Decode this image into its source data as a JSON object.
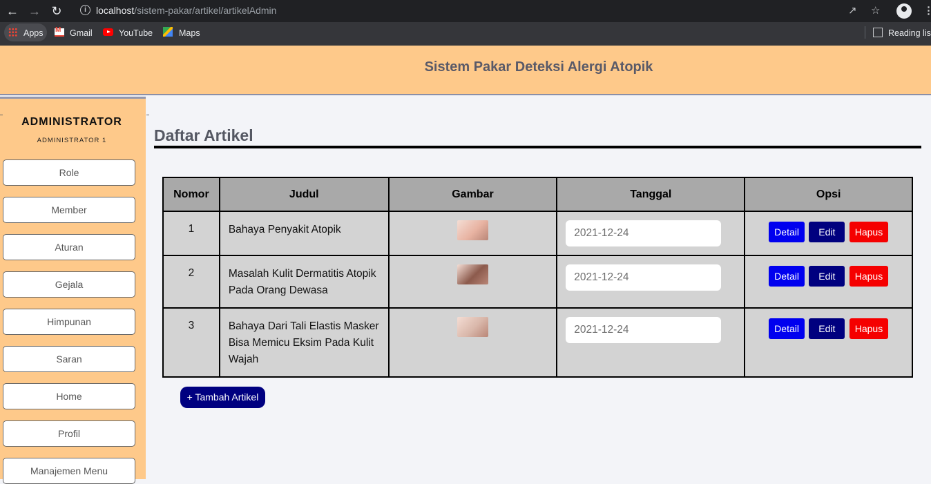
{
  "browser": {
    "url_host": "localhost",
    "url_path": "/sistem-pakar/artikel/artikelAdmin",
    "bookmarks": [
      "Apps",
      "Gmail",
      "YouTube",
      "Maps"
    ],
    "reading_list": "Reading list"
  },
  "header": {
    "title": "Sistem Pakar Deteksi Alergi Atopik"
  },
  "sidebar": {
    "title": "ADMINISTRATOR",
    "subtitle": "ADMINISTRATOR 1",
    "items": [
      "Role",
      "Member",
      "Aturan",
      "Gejala",
      "Himpunan",
      "Saran",
      "Home",
      "Profil",
      "Manajemen Menu"
    ]
  },
  "main": {
    "title": "Daftar Artikel",
    "columns": [
      "Nomor",
      "Judul",
      "Gambar",
      "Tanggal",
      "Opsi"
    ],
    "rows": [
      {
        "no": "1",
        "judul": "Bahaya Penyakit Atopik",
        "tanggal": "2021-12-24",
        "thumb_color": "#e8b3a2"
      },
      {
        "no": "2",
        "judul": "Masalah Kulit Dermatitis Atopik Pada Orang Dewasa",
        "tanggal": "2021-12-24",
        "thumb_color": "#8c5a4c"
      },
      {
        "no": "3",
        "judul": "Bahaya Dari Tali Elastis Masker Bisa Memicu Eksim Pada Kulit Wajah",
        "tanggal": "2021-12-24",
        "thumb_color": "#d9b7aa"
      }
    ],
    "actions": {
      "detail": "Detail",
      "edit": "Edit",
      "hapus": "Hapus"
    },
    "add_button": "+ Tambah Artikel"
  },
  "colors": {
    "header_bg": "#fec98a",
    "detail": "#0000ef",
    "edit": "#00007f",
    "hapus": "#f50000"
  }
}
